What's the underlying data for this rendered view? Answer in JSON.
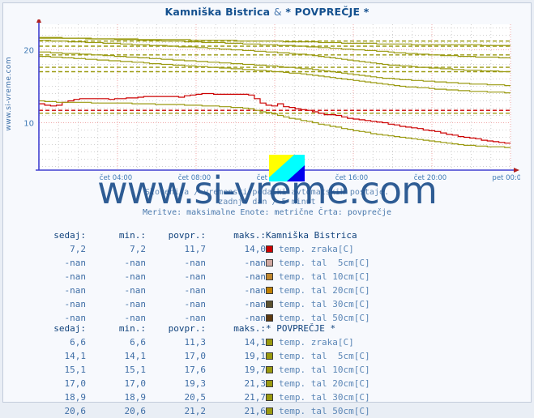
{
  "window": {
    "title": "Kamniška Bistrica & * POVPREČJE *",
    "site_vertical": "www.si-vreme.com",
    "watermark": "www.si-vreme.com"
  },
  "header": {
    "title_part1": "Kamniška Bistrica",
    "title_amp": "&",
    "title_part2": "* POVPREČJE *"
  },
  "captions": {
    "line1": "Slovenija / vremenski podatki avtomatskih postaje.",
    "line2": "zadnji dan / 5 minut",
    "line3": "Meritve: maksimalne  Enote: metrične  Črta: povprečje"
  },
  "colors": {
    "title": "#15518f",
    "axis": "#4040d0",
    "grid_major": "#f0a8a8",
    "grid_minor": "#d0d0d0",
    "text": "#3f6ea6",
    "header_text": "#10427c",
    "series_air_kb": "#cc0000",
    "series_soil5_kb": "#cfa8a0",
    "series_soil10_kb": "#c08830",
    "series_soil20_kb": "#c08000",
    "series_soil30_kb": "#5c5230",
    "series_soil50_kb": "#5e3a10",
    "series_avg": "#9a9a10",
    "plot_bg": "#ffffff",
    "page_bg": "#f7f9fd"
  },
  "chart_data": {
    "type": "line",
    "title": "Kamniška Bistrica & * POVPREČJE *",
    "xlabel": "",
    "ylabel": "",
    "ylim": [
      3.5,
      23.5
    ],
    "yticks": [
      10,
      20
    ],
    "ytick_labels": [
      "10",
      "20"
    ],
    "grid": true,
    "legend_position": "below-as-table",
    "x": [
      "čet 04:00",
      "čet 08:00",
      "čet 12:00",
      "čet 16:00",
      "čet 20:00",
      "pet 00:00"
    ],
    "xtick_labels": [
      "čet 04:00",
      "čet 08:00",
      "čet 12:00",
      "čet 16:00",
      "čet 20:00",
      "pet 00:00"
    ],
    "series": [
      {
        "name": "Kamniška Bistrica temp. zraka[C]",
        "color": "#cc0000",
        "avg_line": 11.7,
        "values": [
          12.6,
          12.4,
          12.3,
          12.4,
          12.8,
          13.0,
          13.2,
          13.3,
          13.3,
          13.3,
          13.3,
          13.3,
          13.2,
          13.3,
          13.3,
          13.4,
          13.4,
          13.5,
          13.6,
          13.6,
          13.6,
          13.6,
          13.6,
          13.6,
          13.5,
          13.7,
          13.8,
          13.9,
          14.0,
          14.0,
          13.9,
          13.9,
          13.9,
          13.9,
          13.9,
          13.9,
          13.8,
          13.3,
          12.7,
          12.4,
          12.3,
          12.6,
          12.2,
          12.1,
          11.9,
          11.8,
          11.7,
          11.5,
          11.3,
          11.1,
          11.1,
          11.0,
          10.8,
          10.6,
          10.5,
          10.4,
          10.3,
          10.2,
          10.1,
          10.0,
          9.8,
          9.7,
          9.5,
          9.4,
          9.3,
          9.2,
          9.0,
          8.9,
          8.8,
          8.6,
          8.4,
          8.3,
          8.1,
          8.0,
          7.9,
          7.8,
          7.6,
          7.5,
          7.4,
          7.3,
          7.2,
          7.2
        ]
      },
      {
        "name": "* POVPREČJE * temp. zraka[C]",
        "color": "#9a9a10",
        "avg_line": 11.3,
        "values": [
          13.0,
          12.9,
          12.9,
          12.8,
          12.8,
          12.8,
          12.8,
          12.8,
          12.8,
          12.7,
          12.7,
          12.7,
          12.7,
          12.7,
          12.7,
          12.7,
          12.6,
          12.6,
          12.6,
          12.6,
          12.5,
          12.5,
          12.5,
          12.5,
          12.5,
          12.4,
          12.4,
          12.4,
          12.3,
          12.3,
          12.3,
          12.2,
          12.2,
          12.1,
          12.1,
          12.0,
          11.9,
          11.7,
          11.5,
          11.4,
          11.2,
          11.0,
          10.8,
          10.6,
          10.5,
          10.3,
          10.2,
          10.0,
          9.8,
          9.7,
          9.5,
          9.4,
          9.2,
          9.1,
          8.9,
          8.8,
          8.7,
          8.5,
          8.4,
          8.3,
          8.2,
          8.1,
          8.0,
          7.9,
          7.8,
          7.7,
          7.6,
          7.5,
          7.4,
          7.3,
          7.2,
          7.1,
          7.0,
          6.9,
          6.9,
          6.8,
          6.8,
          6.7,
          6.7,
          6.7,
          6.6,
          6.6
        ]
      },
      {
        "name": "* POVPREČJE * temp. tal 5cm[C]",
        "color": "#9a9a10",
        "avg_line": 17.0,
        "values": [
          19.1,
          19.1,
          19.0,
          19.0,
          18.9,
          18.9,
          18.8,
          18.8,
          18.7,
          18.7,
          18.6,
          18.6,
          18.5,
          18.5,
          18.4,
          18.4,
          18.3,
          18.3,
          18.2,
          18.1,
          18.1,
          18.0,
          18.0,
          17.9,
          17.9,
          17.8,
          17.8,
          17.7,
          17.7,
          17.6,
          17.6,
          17.5,
          17.5,
          17.4,
          17.4,
          17.3,
          17.3,
          17.2,
          17.2,
          17.1,
          17.0,
          17.0,
          16.9,
          16.8,
          16.8,
          16.7,
          16.6,
          16.5,
          16.4,
          16.3,
          16.2,
          16.1,
          16.0,
          15.9,
          15.8,
          15.7,
          15.6,
          15.5,
          15.4,
          15.3,
          15.2,
          15.1,
          15.0,
          14.9,
          14.9,
          14.8,
          14.8,
          14.7,
          14.6,
          14.6,
          14.5,
          14.5,
          14.4,
          14.4,
          14.3,
          14.3,
          14.3,
          14.2,
          14.2,
          14.2,
          14.1,
          14.1
        ]
      },
      {
        "name": "* POVPREČJE * temp. tal 10cm[C]",
        "color": "#9a9a10",
        "avg_line": 17.6,
        "values": [
          19.7,
          19.7,
          19.6,
          19.6,
          19.5,
          19.5,
          19.5,
          19.4,
          19.4,
          19.3,
          19.3,
          19.2,
          19.2,
          19.1,
          19.1,
          19.0,
          19.0,
          18.9,
          18.9,
          18.8,
          18.8,
          18.7,
          18.7,
          18.6,
          18.6,
          18.5,
          18.5,
          18.4,
          18.4,
          18.3,
          18.3,
          18.2,
          18.2,
          18.1,
          18.1,
          18.0,
          18.0,
          17.9,
          17.9,
          17.8,
          17.8,
          17.7,
          17.6,
          17.6,
          17.5,
          17.4,
          17.4,
          17.3,
          17.2,
          17.1,
          17.0,
          16.9,
          16.8,
          16.7,
          16.6,
          16.5,
          16.4,
          16.3,
          16.2,
          16.1,
          16.1,
          16.0,
          15.9,
          15.9,
          15.8,
          15.8,
          15.7,
          15.7,
          15.6,
          15.6,
          15.5,
          15.5,
          15.4,
          15.4,
          15.3,
          15.3,
          15.3,
          15.2,
          15.2,
          15.2,
          15.1,
          15.1
        ]
      },
      {
        "name": "* POVPREČJE * temp. tal 20cm[C]",
        "color": "#9a9a10",
        "avg_line": 19.3,
        "values": [
          21.3,
          21.3,
          21.2,
          21.2,
          21.2,
          21.1,
          21.1,
          21.1,
          21.0,
          21.0,
          21.0,
          20.9,
          20.9,
          20.9,
          20.8,
          20.8,
          20.7,
          20.7,
          20.7,
          20.6,
          20.6,
          20.6,
          20.5,
          20.5,
          20.4,
          20.4,
          20.4,
          20.3,
          20.3,
          20.2,
          20.2,
          20.1,
          20.1,
          20.0,
          20.0,
          19.9,
          19.9,
          19.8,
          19.8,
          19.7,
          19.7,
          19.6,
          19.6,
          19.5,
          19.4,
          19.4,
          19.3,
          19.2,
          19.1,
          19.0,
          18.9,
          18.8,
          18.7,
          18.6,
          18.5,
          18.4,
          18.3,
          18.2,
          18.1,
          18.0,
          17.9,
          17.9,
          17.8,
          17.8,
          17.7,
          17.6,
          17.6,
          17.5,
          17.5,
          17.4,
          17.4,
          17.3,
          17.3,
          17.2,
          17.2,
          17.2,
          17.1,
          17.1,
          17.1,
          17.0,
          17.0,
          17.0
        ]
      },
      {
        "name": "* POVPREČJE * temp. tal 30cm[C]",
        "color": "#9a9a10",
        "avg_line": 20.5,
        "values": [
          21.7,
          21.7,
          21.7,
          21.7,
          21.6,
          21.6,
          21.6,
          21.6,
          21.6,
          21.5,
          21.5,
          21.5,
          21.5,
          21.4,
          21.4,
          21.4,
          21.4,
          21.3,
          21.3,
          21.3,
          21.3,
          21.2,
          21.2,
          21.2,
          21.2,
          21.1,
          21.1,
          21.1,
          21.0,
          21.0,
          21.0,
          21.0,
          20.9,
          20.9,
          20.9,
          20.8,
          20.8,
          20.8,
          20.7,
          20.7,
          20.7,
          20.6,
          20.6,
          20.6,
          20.5,
          20.5,
          20.4,
          20.4,
          20.3,
          20.3,
          20.2,
          20.2,
          20.1,
          20.1,
          20.0,
          20.0,
          19.9,
          19.9,
          19.8,
          19.8,
          19.7,
          19.6,
          19.6,
          19.5,
          19.5,
          19.4,
          19.4,
          19.3,
          19.3,
          19.2,
          19.2,
          19.2,
          19.1,
          19.1,
          19.1,
          19.0,
          19.0,
          19.0,
          19.0,
          18.9,
          18.9,
          18.9
        ]
      },
      {
        "name": "* POVPREČJE * temp. tal 50cm[C]",
        "color": "#9a9a10",
        "avg_line": 21.2,
        "values": [
          21.6,
          21.6,
          21.6,
          21.6,
          21.6,
          21.6,
          21.6,
          21.6,
          21.5,
          21.5,
          21.5,
          21.5,
          21.5,
          21.5,
          21.5,
          21.5,
          21.5,
          21.4,
          21.4,
          21.4,
          21.4,
          21.4,
          21.4,
          21.4,
          21.4,
          21.4,
          21.3,
          21.3,
          21.3,
          21.3,
          21.3,
          21.3,
          21.3,
          21.3,
          21.2,
          21.2,
          21.2,
          21.2,
          21.2,
          21.2,
          21.2,
          21.2,
          21.1,
          21.1,
          21.1,
          21.1,
          21.1,
          21.1,
          21.0,
          21.0,
          21.0,
          21.0,
          20.9,
          20.9,
          20.9,
          20.9,
          20.9,
          20.9,
          20.8,
          20.8,
          20.8,
          20.8,
          20.8,
          20.8,
          20.7,
          20.7,
          20.7,
          20.7,
          20.7,
          20.7,
          20.7,
          20.7,
          20.7,
          20.7,
          20.7,
          20.7,
          20.6,
          20.6,
          20.6,
          20.6,
          20.6,
          20.6
        ]
      }
    ]
  },
  "tables": [
    {
      "id": "kamniska-bistrica",
      "headers": [
        "sedaj:",
        "min.:",
        "povpr.:",
        "maks.:"
      ],
      "station": "Kamniška Bistrica",
      "rows": [
        {
          "sedaj": "7,2",
          "min": "7,2",
          "povpr": "11,7",
          "maks": "14,0",
          "color": "#cc0000",
          "label": "temp. zraka[C]"
        },
        {
          "sedaj": "-nan",
          "min": "-nan",
          "povpr": "-nan",
          "maks": "-nan",
          "color": "#cfa8a0",
          "label": "temp. tal  5cm[C]"
        },
        {
          "sedaj": "-nan",
          "min": "-nan",
          "povpr": "-nan",
          "maks": "-nan",
          "color": "#c08830",
          "label": "temp. tal 10cm[C]"
        },
        {
          "sedaj": "-nan",
          "min": "-nan",
          "povpr": "-nan",
          "maks": "-nan",
          "color": "#c08000",
          "label": "temp. tal 20cm[C]"
        },
        {
          "sedaj": "-nan",
          "min": "-nan",
          "povpr": "-nan",
          "maks": "-nan",
          "color": "#5c5230",
          "label": "temp. tal 30cm[C]"
        },
        {
          "sedaj": "-nan",
          "min": "-nan",
          "povpr": "-nan",
          "maks": "-nan",
          "color": "#5e3a10",
          "label": "temp. tal 50cm[C]"
        }
      ]
    },
    {
      "id": "povprecje",
      "headers": [
        "sedaj:",
        "min.:",
        "povpr.:",
        "maks.:"
      ],
      "station": "* POVPREČJE *",
      "rows": [
        {
          "sedaj": "6,6",
          "min": "6,6",
          "povpr": "11,3",
          "maks": "14,1",
          "color": "#9a9a10",
          "label": "temp. zraka[C]"
        },
        {
          "sedaj": "14,1",
          "min": "14,1",
          "povpr": "17,0",
          "maks": "19,1",
          "color": "#9a9a10",
          "label": "temp. tal  5cm[C]"
        },
        {
          "sedaj": "15,1",
          "min": "15,1",
          "povpr": "17,6",
          "maks": "19,7",
          "color": "#9a9a10",
          "label": "temp. tal 10cm[C]"
        },
        {
          "sedaj": "17,0",
          "min": "17,0",
          "povpr": "19,3",
          "maks": "21,3",
          "color": "#9a9a10",
          "label": "temp. tal 20cm[C]"
        },
        {
          "sedaj": "18,9",
          "min": "18,9",
          "povpr": "20,5",
          "maks": "21,7",
          "color": "#9a9a10",
          "label": "temp. tal 30cm[C]"
        },
        {
          "sedaj": "20,6",
          "min": "20,6",
          "povpr": "21,2",
          "maks": "21,6",
          "color": "#9a9a10",
          "label": "temp. tal 50cm[C]"
        }
      ]
    }
  ]
}
